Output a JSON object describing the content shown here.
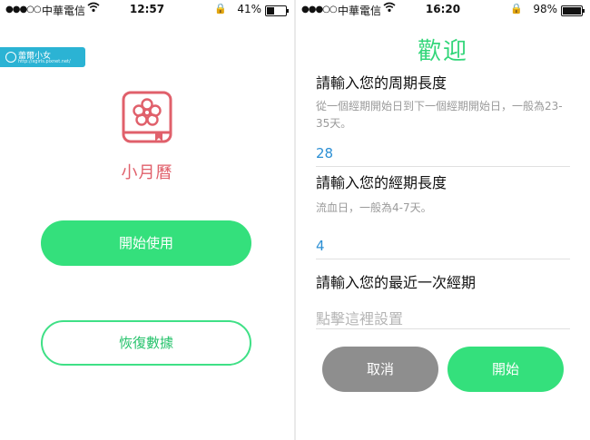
{
  "left": {
    "status": {
      "carrier": "中華電信",
      "time": "12:57",
      "battery": "41%",
      "battery_level": 0.41
    },
    "watermark": {
      "line1": "蕾爾小女",
      "line2": "http://xgirls.pixnet.net/"
    },
    "app_name": "小月曆",
    "start_label": "開始使用",
    "restore_label": "恢復數據"
  },
  "right": {
    "status": {
      "carrier": "中華電信",
      "time": "16:20",
      "battery": "98%",
      "battery_level": 0.98
    },
    "title": "歡迎",
    "cycle": {
      "label": "請輸入您的周期長度",
      "hint": "從一個經期開始日到下一個經期開始日，一般為23-35天。",
      "value": "28"
    },
    "period": {
      "label": "請輸入您的經期長度",
      "hint": "流血日，一般為4-7天。",
      "value": "4"
    },
    "last": {
      "label": "請輸入您的最近一次經期",
      "placeholder": "點擊這裡設置"
    },
    "cancel_label": "取消",
    "start_label": "開始"
  },
  "colors": {
    "accent": "#34e07c",
    "icon_red": "#e0606b",
    "value_blue": "#2b8fd4",
    "cancel_gray": "#8e8e8e"
  },
  "icons": [
    "signal-icon",
    "wifi-icon",
    "orientation-lock-icon",
    "battery-icon",
    "flower-book-icon"
  ]
}
